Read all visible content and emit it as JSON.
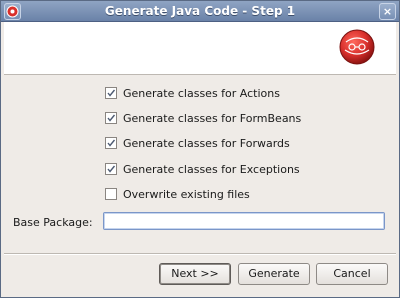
{
  "window": {
    "title": "Generate Java Code - Step 1",
    "close_glyph": "×",
    "app_icon": "app-logo-icon"
  },
  "banner": {
    "logo_icon": "wizard-logo-icon"
  },
  "options": [
    {
      "label": "Generate classes for Actions",
      "checked": true
    },
    {
      "label": "Generate classes for FormBeans",
      "checked": true
    },
    {
      "label": "Generate classes for Forwards",
      "checked": true
    },
    {
      "label": "Generate classes for Exceptions",
      "checked": true
    },
    {
      "label": "Overwrite existing files",
      "checked": false
    }
  ],
  "base_package": {
    "label": "Base Package:",
    "value": ""
  },
  "buttons": {
    "next": "Next >>",
    "generate": "Generate",
    "cancel": "Cancel"
  },
  "colors": {
    "titlebar": "#7890b5",
    "dialog_bg": "#efebe7",
    "logo_red": "#d9302c",
    "check_mark": "#4d5a72"
  }
}
